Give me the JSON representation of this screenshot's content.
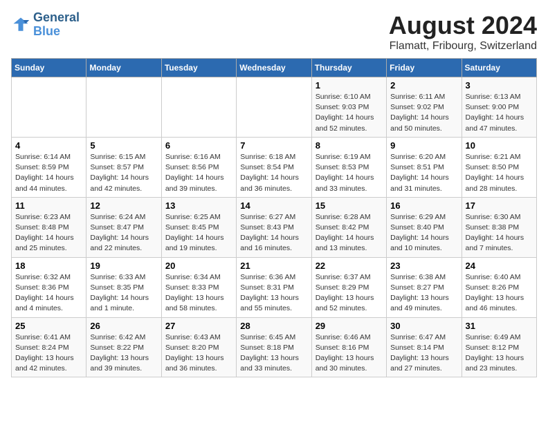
{
  "logo": {
    "line1": "General",
    "line2": "Blue"
  },
  "title": "August 2024",
  "subtitle": "Flamatt, Fribourg, Switzerland",
  "days_of_week": [
    "Sunday",
    "Monday",
    "Tuesday",
    "Wednesday",
    "Thursday",
    "Friday",
    "Saturday"
  ],
  "weeks": [
    [
      {
        "day": "",
        "detail": ""
      },
      {
        "day": "",
        "detail": ""
      },
      {
        "day": "",
        "detail": ""
      },
      {
        "day": "",
        "detail": ""
      },
      {
        "day": "1",
        "detail": "Sunrise: 6:10 AM\nSunset: 9:03 PM\nDaylight: 14 hours\nand 52 minutes."
      },
      {
        "day": "2",
        "detail": "Sunrise: 6:11 AM\nSunset: 9:02 PM\nDaylight: 14 hours\nand 50 minutes."
      },
      {
        "day": "3",
        "detail": "Sunrise: 6:13 AM\nSunset: 9:00 PM\nDaylight: 14 hours\nand 47 minutes."
      }
    ],
    [
      {
        "day": "4",
        "detail": "Sunrise: 6:14 AM\nSunset: 8:59 PM\nDaylight: 14 hours\nand 44 minutes."
      },
      {
        "day": "5",
        "detail": "Sunrise: 6:15 AM\nSunset: 8:57 PM\nDaylight: 14 hours\nand 42 minutes."
      },
      {
        "day": "6",
        "detail": "Sunrise: 6:16 AM\nSunset: 8:56 PM\nDaylight: 14 hours\nand 39 minutes."
      },
      {
        "day": "7",
        "detail": "Sunrise: 6:18 AM\nSunset: 8:54 PM\nDaylight: 14 hours\nand 36 minutes."
      },
      {
        "day": "8",
        "detail": "Sunrise: 6:19 AM\nSunset: 8:53 PM\nDaylight: 14 hours\nand 33 minutes."
      },
      {
        "day": "9",
        "detail": "Sunrise: 6:20 AM\nSunset: 8:51 PM\nDaylight: 14 hours\nand 31 minutes."
      },
      {
        "day": "10",
        "detail": "Sunrise: 6:21 AM\nSunset: 8:50 PM\nDaylight: 14 hours\nand 28 minutes."
      }
    ],
    [
      {
        "day": "11",
        "detail": "Sunrise: 6:23 AM\nSunset: 8:48 PM\nDaylight: 14 hours\nand 25 minutes."
      },
      {
        "day": "12",
        "detail": "Sunrise: 6:24 AM\nSunset: 8:47 PM\nDaylight: 14 hours\nand 22 minutes."
      },
      {
        "day": "13",
        "detail": "Sunrise: 6:25 AM\nSunset: 8:45 PM\nDaylight: 14 hours\nand 19 minutes."
      },
      {
        "day": "14",
        "detail": "Sunrise: 6:27 AM\nSunset: 8:43 PM\nDaylight: 14 hours\nand 16 minutes."
      },
      {
        "day": "15",
        "detail": "Sunrise: 6:28 AM\nSunset: 8:42 PM\nDaylight: 14 hours\nand 13 minutes."
      },
      {
        "day": "16",
        "detail": "Sunrise: 6:29 AM\nSunset: 8:40 PM\nDaylight: 14 hours\nand 10 minutes."
      },
      {
        "day": "17",
        "detail": "Sunrise: 6:30 AM\nSunset: 8:38 PM\nDaylight: 14 hours\nand 7 minutes."
      }
    ],
    [
      {
        "day": "18",
        "detail": "Sunrise: 6:32 AM\nSunset: 8:36 PM\nDaylight: 14 hours\nand 4 minutes."
      },
      {
        "day": "19",
        "detail": "Sunrise: 6:33 AM\nSunset: 8:35 PM\nDaylight: 14 hours\nand 1 minute."
      },
      {
        "day": "20",
        "detail": "Sunrise: 6:34 AM\nSunset: 8:33 PM\nDaylight: 13 hours\nand 58 minutes."
      },
      {
        "day": "21",
        "detail": "Sunrise: 6:36 AM\nSunset: 8:31 PM\nDaylight: 13 hours\nand 55 minutes."
      },
      {
        "day": "22",
        "detail": "Sunrise: 6:37 AM\nSunset: 8:29 PM\nDaylight: 13 hours\nand 52 minutes."
      },
      {
        "day": "23",
        "detail": "Sunrise: 6:38 AM\nSunset: 8:27 PM\nDaylight: 13 hours\nand 49 minutes."
      },
      {
        "day": "24",
        "detail": "Sunrise: 6:40 AM\nSunset: 8:26 PM\nDaylight: 13 hours\nand 46 minutes."
      }
    ],
    [
      {
        "day": "25",
        "detail": "Sunrise: 6:41 AM\nSunset: 8:24 PM\nDaylight: 13 hours\nand 42 minutes."
      },
      {
        "day": "26",
        "detail": "Sunrise: 6:42 AM\nSunset: 8:22 PM\nDaylight: 13 hours\nand 39 minutes."
      },
      {
        "day": "27",
        "detail": "Sunrise: 6:43 AM\nSunset: 8:20 PM\nDaylight: 13 hours\nand 36 minutes."
      },
      {
        "day": "28",
        "detail": "Sunrise: 6:45 AM\nSunset: 8:18 PM\nDaylight: 13 hours\nand 33 minutes."
      },
      {
        "day": "29",
        "detail": "Sunrise: 6:46 AM\nSunset: 8:16 PM\nDaylight: 13 hours\nand 30 minutes."
      },
      {
        "day": "30",
        "detail": "Sunrise: 6:47 AM\nSunset: 8:14 PM\nDaylight: 13 hours\nand 27 minutes."
      },
      {
        "day": "31",
        "detail": "Sunrise: 6:49 AM\nSunset: 8:12 PM\nDaylight: 13 hours\nand 23 minutes."
      }
    ]
  ]
}
